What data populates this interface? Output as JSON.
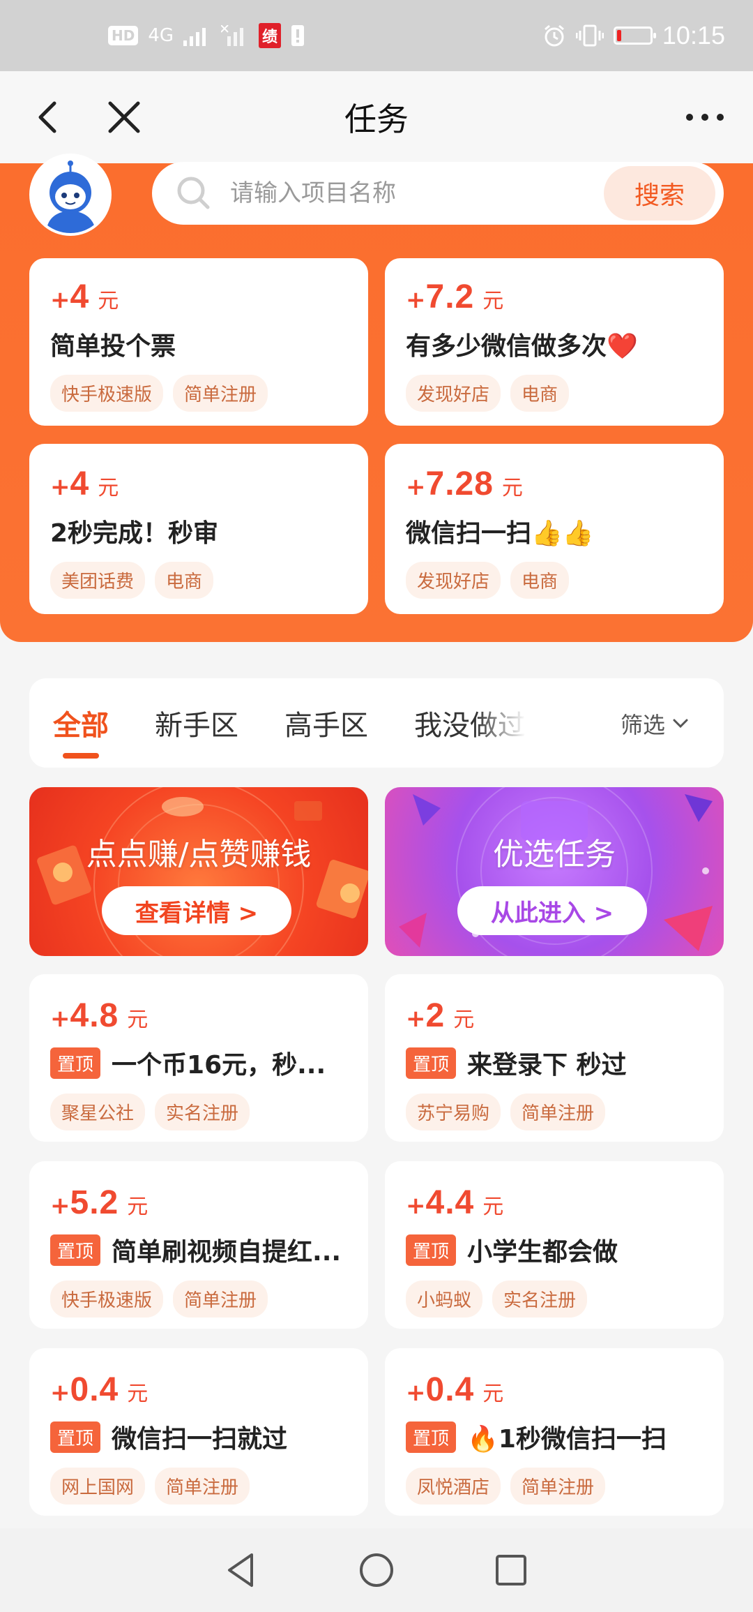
{
  "status_bar": {
    "hd_label": "HD",
    "network_label": "4G",
    "app_badge": "绩",
    "time": "10:15",
    "battery_level": 0.12
  },
  "nav": {
    "title": "任务",
    "more_label": "•••"
  },
  "search": {
    "placeholder": "请输入项目名称",
    "button_label": "搜索"
  },
  "featured_tasks": [
    {
      "plus": "+",
      "amount": "4",
      "unit": "元",
      "title": "简单投个票",
      "tags": [
        "快手极速版",
        "简单注册"
      ]
    },
    {
      "plus": "+",
      "amount": "7.2",
      "unit": "元",
      "title": "有多少微信做多次❤️",
      "tags": [
        "发现好店",
        "电商"
      ]
    },
    {
      "plus": "+",
      "amount": "4",
      "unit": "元",
      "title": "2秒完成！秒审",
      "tags": [
        "美团话费",
        "电商"
      ]
    },
    {
      "plus": "+",
      "amount": "7.28",
      "unit": "元",
      "title": "微信扫一扫👍👍",
      "tags": [
        "发现好店",
        "电商"
      ]
    }
  ],
  "tabs": [
    {
      "label": "全部",
      "active": true
    },
    {
      "label": "新手区",
      "active": false
    },
    {
      "label": "高手区",
      "active": false
    },
    {
      "label": "我没做过",
      "active": false
    }
  ],
  "filter_label": "筛选",
  "banners": [
    {
      "title": "点点赚/点赞赚钱",
      "button": "查看详情 >"
    },
    {
      "title": "优选任务",
      "button": "从此进入 >"
    }
  ],
  "task_list": [
    {
      "plus": "+",
      "amount": "4.8",
      "unit": "元",
      "badge": "置顶",
      "title": "一个币16元，秒...",
      "tags": [
        "聚星公社",
        "实名注册"
      ]
    },
    {
      "plus": "+",
      "amount": "2",
      "unit": "元",
      "badge": "置顶",
      "title": "来登录下  秒过",
      "tags": [
        "苏宁易购",
        "简单注册"
      ]
    },
    {
      "plus": "+",
      "amount": "5.2",
      "unit": "元",
      "badge": "置顶",
      "title": "简单刷视频自提红...",
      "tags": [
        "快手极速版",
        "简单注册"
      ]
    },
    {
      "plus": "+",
      "amount": "4.4",
      "unit": "元",
      "badge": "置顶",
      "title": "小学生都会做",
      "tags": [
        "小蚂蚁",
        "实名注册"
      ]
    },
    {
      "plus": "+",
      "amount": "0.4",
      "unit": "元",
      "badge": "置顶",
      "title": "微信扫一扫就过",
      "tags": [
        "网上国网",
        "简单注册"
      ]
    },
    {
      "plus": "+",
      "amount": "0.4",
      "unit": "元",
      "badge": "置顶",
      "title": "🔥1秒微信扫一扫",
      "tags": [
        "凤悦酒店",
        "简单注册"
      ]
    }
  ],
  "colors": {
    "brand_orange": "#fb6e2e",
    "reward_red": "#f04a30",
    "tag_text": "#c96a3e"
  }
}
